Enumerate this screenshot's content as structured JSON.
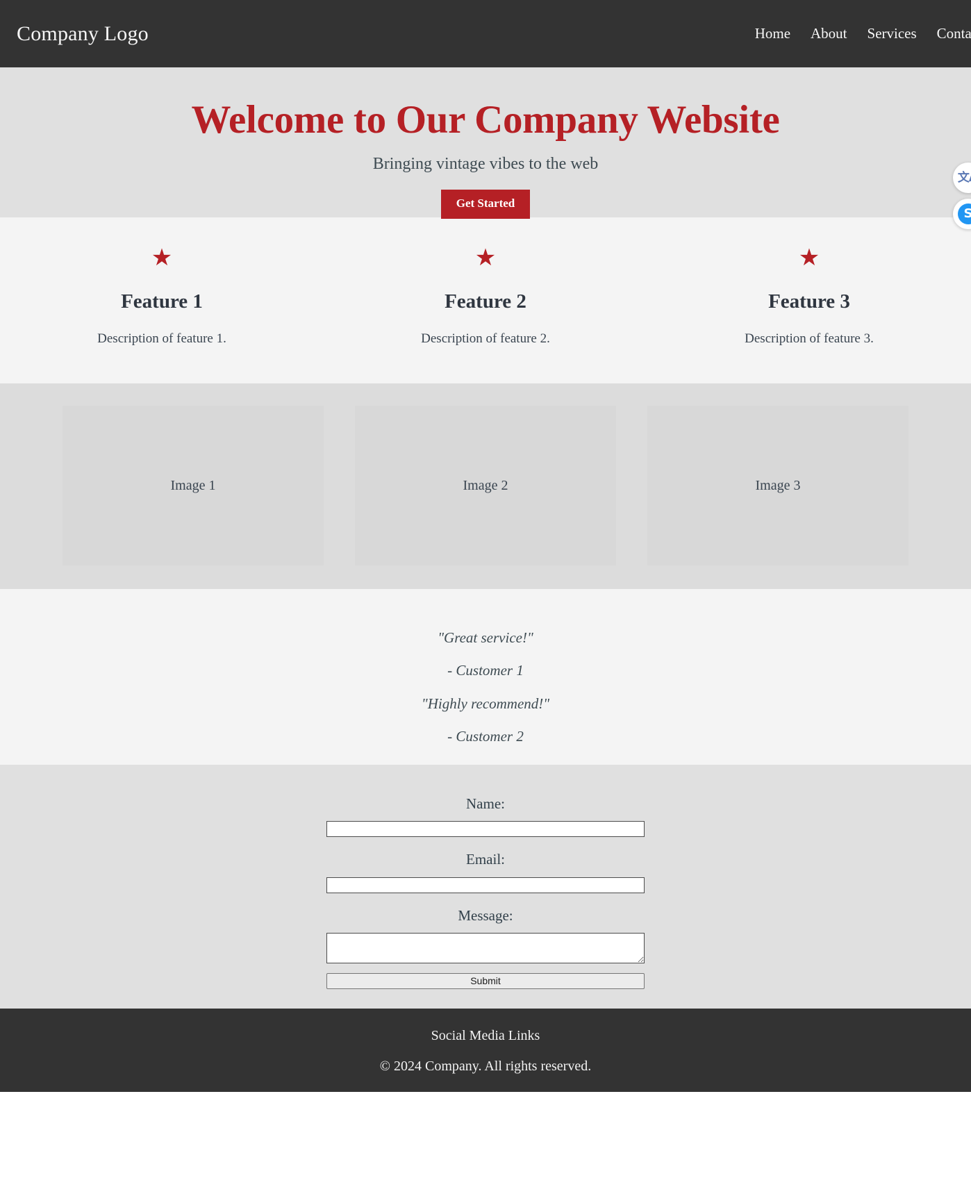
{
  "header": {
    "logo": "Company Logo",
    "nav": [
      {
        "label": "Home"
      },
      {
        "label": "About"
      },
      {
        "label": "Services"
      },
      {
        "label": "Contact"
      }
    ]
  },
  "hero": {
    "title": "Welcome to Our Company Website",
    "subtitle": "Bringing vintage vibes to the web",
    "cta_label": "Get Started",
    "accent_color": "#b52025"
  },
  "features": [
    {
      "icon": "star-icon",
      "glyph": "★",
      "title": "Feature 1",
      "description": "Description of feature 1."
    },
    {
      "icon": "star-icon",
      "glyph": "★",
      "title": "Feature 2",
      "description": "Description of feature 2."
    },
    {
      "icon": "star-icon",
      "glyph": "★",
      "title": "Feature 3",
      "description": "Description of feature 3."
    }
  ],
  "gallery": [
    {
      "caption": "Image 1"
    },
    {
      "caption": "Image 2"
    },
    {
      "caption": "Image 3"
    }
  ],
  "testimonials": [
    {
      "text": "\"Great service!\""
    },
    {
      "text": "- Customer 1"
    },
    {
      "text": "\"Highly recommend!\""
    },
    {
      "text": "- Customer 2"
    }
  ],
  "contact": {
    "name_label": "Name:",
    "name_value": "",
    "email_label": "Email:",
    "email_value": "",
    "message_label": "Message:",
    "message_value": "",
    "submit_label": "Submit"
  },
  "footer": {
    "social_links_label": "Social Media Links",
    "copyright": "© 2024 Company. All rights reserved."
  },
  "float_widgets": [
    {
      "name": "translate-icon",
      "glyph": "文A"
    },
    {
      "name": "assistant-icon",
      "glyph": "S"
    }
  ]
}
